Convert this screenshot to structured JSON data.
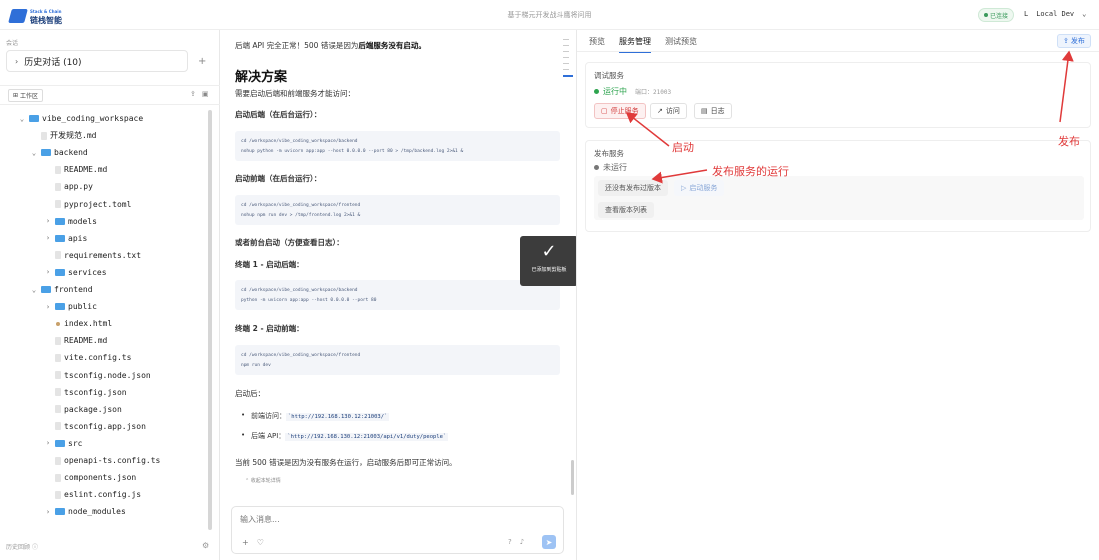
{
  "topbar": {
    "logo_name": "链栈智能",
    "logo_sub": "Stack & Chain",
    "title": "基于梯元开发战斗鹰将问用",
    "connection": "已连接",
    "user_initial": "L",
    "user_label": "Local Dev",
    "chevron": "⌄"
  },
  "sidebar": {
    "section_label": "会话",
    "history_label": "历史对话 (10)",
    "add": "+",
    "workspace_btn": "工作区",
    "footer_label": "历史回顾",
    "tree": [
      {
        "label": "vibe_coding_workspace",
        "kind": "folder",
        "depth": 0,
        "open": true
      },
      {
        "label": "开发规范.md",
        "kind": "file",
        "depth": 1
      },
      {
        "label": "backend",
        "kind": "folder",
        "depth": 1,
        "open": true
      },
      {
        "label": "README.md",
        "kind": "file",
        "depth": 2
      },
      {
        "label": "app.py",
        "kind": "file",
        "depth": 2
      },
      {
        "label": "pyproject.toml",
        "kind": "file",
        "depth": 2
      },
      {
        "label": "models",
        "kind": "folder",
        "depth": 2,
        "open": false
      },
      {
        "label": "apis",
        "kind": "folder",
        "depth": 2,
        "open": false
      },
      {
        "label": "requirements.txt",
        "kind": "file",
        "depth": 2
      },
      {
        "label": "services",
        "kind": "folder",
        "depth": 2,
        "open": false
      },
      {
        "label": "frontend",
        "kind": "folder",
        "depth": 1,
        "open": true
      },
      {
        "label": "public",
        "kind": "folder",
        "depth": 2,
        "open": false
      },
      {
        "label": "index.html",
        "kind": "html",
        "depth": 2
      },
      {
        "label": "README.md",
        "kind": "file",
        "depth": 2
      },
      {
        "label": "vite.config.ts",
        "kind": "file",
        "depth": 2
      },
      {
        "label": "tsconfig.node.json",
        "kind": "file",
        "depth": 2
      },
      {
        "label": "tsconfig.json",
        "kind": "file",
        "depth": 2
      },
      {
        "label": "package.json",
        "kind": "file",
        "depth": 2
      },
      {
        "label": "tsconfig.app.json",
        "kind": "file",
        "depth": 2
      },
      {
        "label": "src",
        "kind": "folder",
        "depth": 2,
        "open": false
      },
      {
        "label": "openapi-ts.config.ts",
        "kind": "file",
        "depth": 2
      },
      {
        "label": "components.json",
        "kind": "file",
        "depth": 2
      },
      {
        "label": "eslint.config.js",
        "kind": "file",
        "depth": 2
      },
      {
        "label": "node_modules",
        "kind": "folder",
        "depth": 2,
        "open": false
      }
    ]
  },
  "chat": {
    "line1_pre": "后端 API 完全正常！500 错误是因为",
    "line1_bold": "后端服务没有启动。",
    "heading": "解决方案",
    "intro": "需要启动后端和前端服务才能访问：",
    "backend_title": "启动后端（在后台运行）：",
    "backend_code_1": "cd /workspace/vibe_coding_workspace/backend",
    "backend_code_2": "nohup python -m uvicorn app:app --host 0.0.0.0 --port 80 > /tmp/backend.log 2>&1 &",
    "frontend_title": "启动前端（在后台运行）：",
    "frontend_code_1": "cd /workspace/vibe_coding_workspace/frontend",
    "frontend_code_2": "nohup npm run dev > /tmp/frontend.log 2>&1 &",
    "fg_title": "或者前台启动（方便查看日志）：",
    "term1_title": "终端 1 - 启动后端：",
    "term1_code_1": "cd /workspace/vibe_coding_workspace/backend",
    "term1_code_2": "python -m uvicorn app:app --host 0.0.0.0 --port 80",
    "term2_title": "终端 2 - 启动前端：",
    "term2_code_1": "cd /workspace/vibe_coding_workspace/frontend",
    "term2_code_2": "npm run dev",
    "after": "启动后：",
    "bullet1_label": "前端访问：",
    "bullet1_link": "`http://192.168.130.12:21003/`",
    "bullet2_label": "后端 API：",
    "bullet2_link": "`http://192.168.130.12:21003/api/v1/duty/people`",
    "conclusion": "当前 500 错误是因为没有服务在运行，启动服务后即可正常访问。",
    "collapse": "⌃ 收起本轮详情",
    "input_placeholder": "输入消息...",
    "toast": "已添加到剪贴板"
  },
  "panel": {
    "tabs": [
      "预览",
      "服务管理",
      "测试预览"
    ],
    "active_tab": 1,
    "publish_btn": "发布",
    "debug_title": "调试服务",
    "debug_status": "运行中",
    "debug_port": "端口：21003",
    "stop_btn": "停止服务",
    "visit_btn": "访问",
    "log_btn": "日志",
    "release_title": "发布服务",
    "release_status": "未运行",
    "no_version_btn": "还没有发布过版本",
    "start_btn": "启动服务",
    "version_list_btn": "查看版本列表",
    "colors": {
      "running": "#2ea44f",
      "stopped": "#777777",
      "accent": "#2f6fd8",
      "annotation": "#e03a3a"
    }
  },
  "annotations": {
    "start": "启动",
    "publish": "发布",
    "publish_run": "发布服务的运行"
  }
}
